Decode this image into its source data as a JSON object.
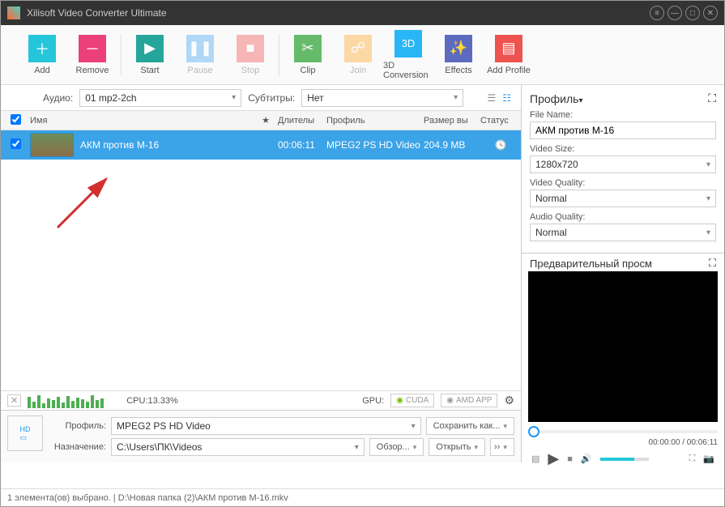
{
  "app": {
    "title": "Xilisoft Video Converter Ultimate"
  },
  "toolbar": {
    "add": "Add",
    "remove": "Remove",
    "start": "Start",
    "pause": "Pause",
    "stop": "Stop",
    "clip": "Clip",
    "join": "Join",
    "conv3d": "3D Conversion",
    "effects": "Effects",
    "addprofile": "Add Profile"
  },
  "subbar": {
    "audio_label": "Аудио:",
    "audio_value": "01 mp2-2ch",
    "subtitle_label": "Субтитры:",
    "subtitle_value": "Нет"
  },
  "columns": {
    "name": "Имя",
    "star": "★",
    "duration": "Длителы",
    "profile": "Профиль",
    "size": "Размер вы",
    "status": "Статус"
  },
  "item": {
    "name": "АКМ против М-16",
    "duration": "00:06:11",
    "profile": "MPEG2 PS HD Video",
    "size": "204.9 MB"
  },
  "cpu": {
    "label": "CPU:13.33%",
    "gpu_label": "GPU:",
    "cuda": "CUDA",
    "amd": "AMD APP"
  },
  "bottom": {
    "profile_label": "Профиль:",
    "profile_value": "MPEG2 PS HD Video",
    "save_as": "Сохранить как...",
    "dest_label": "Назначение:",
    "dest_value": "C:\\Users\\ПК\\Videos",
    "browse": "Обзор...",
    "open": "Открыть"
  },
  "status": {
    "text": "1 элемента(ов) выбрано. | D:\\Новая папка (2)\\АКМ против М-16.mkv"
  },
  "profile": {
    "header": "Профиль",
    "filename_label": "File Name:",
    "filename_value": "АКМ против М-16",
    "videosize_label": "Video Size:",
    "videosize_value": "1280x720",
    "videoq_label": "Video Quality:",
    "videoq_value": "Normal",
    "audioq_label": "Audio Quality:",
    "audioq_value": "Normal"
  },
  "preview": {
    "header": "Предварительный просм",
    "time": "00:00:00 / 00:06:11"
  }
}
